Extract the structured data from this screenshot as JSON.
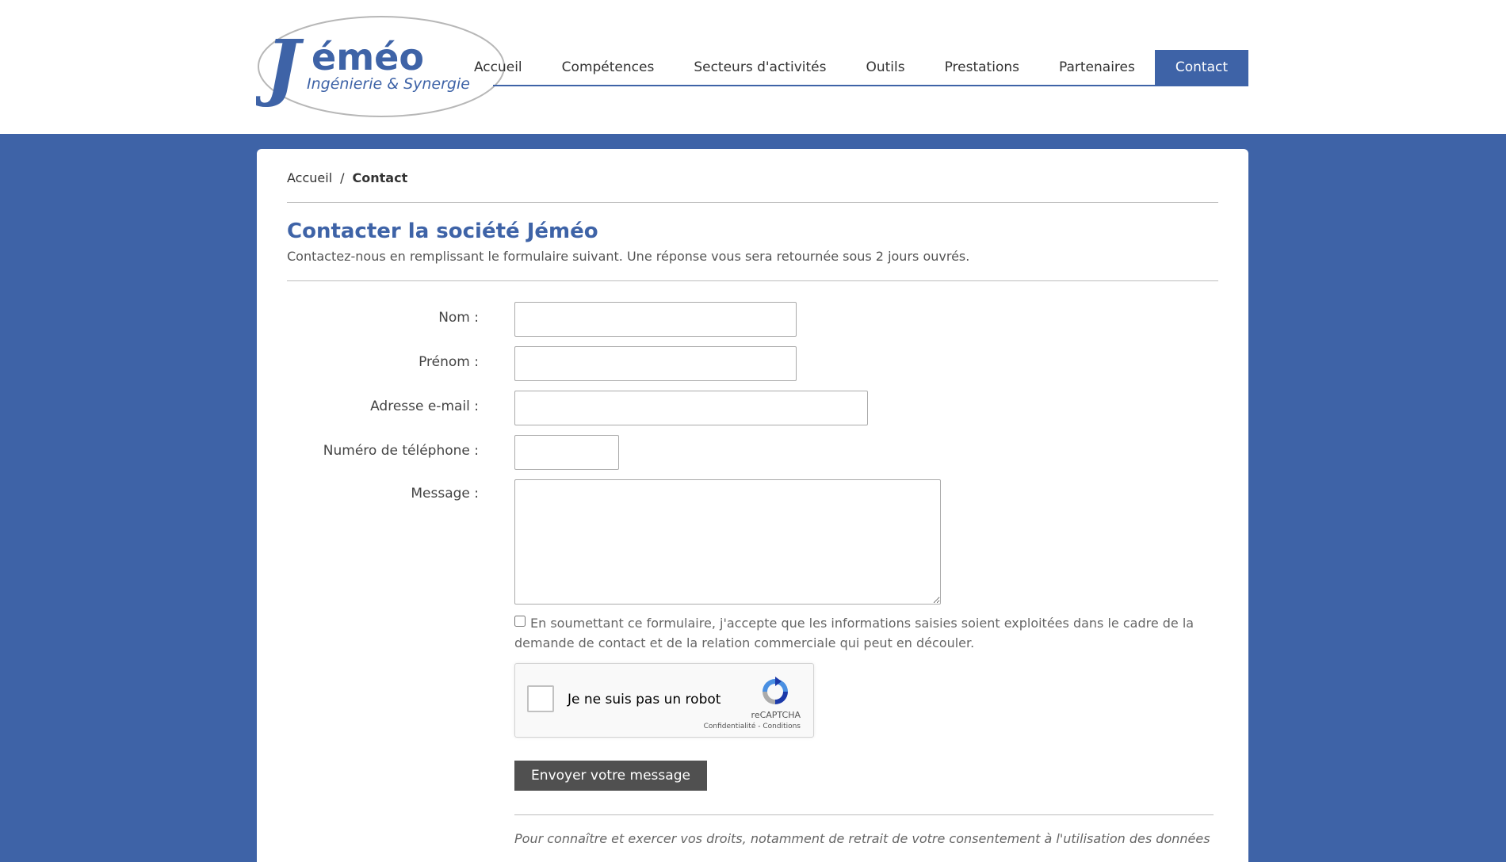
{
  "header": {
    "logo": {
      "name": "Jéméo",
      "tagline": "Ingénierie & Synergie"
    },
    "nav": [
      {
        "label": "Accueil"
      },
      {
        "label": "Compétences"
      },
      {
        "label": "Secteurs d'activités"
      },
      {
        "label": "Outils"
      },
      {
        "label": "Prestations"
      },
      {
        "label": "Partenaires"
      },
      {
        "label": "Contact",
        "active": true
      }
    ]
  },
  "breadcrumb": {
    "home": "Accueil",
    "separator": "/",
    "current": "Contact"
  },
  "page": {
    "title": "Contacter la société Jéméo",
    "intro": "Contactez-nous en remplissant le formulaire suivant. Une réponse vous sera retournée sous 2 jours ouvrés."
  },
  "form": {
    "nom": {
      "label": "Nom :",
      "value": ""
    },
    "prenom": {
      "label": "Prénom :",
      "value": ""
    },
    "email": {
      "label": "Adresse e-mail :",
      "value": ""
    },
    "phone": {
      "label": "Numéro de téléphone :",
      "value": ""
    },
    "message": {
      "label": "Message :",
      "value": ""
    },
    "consent": {
      "checked": false,
      "text": "En soumettant ce formulaire, j'accepte que les informations saisies soient exploitées dans le cadre de la demande de contact et de la relation commerciale qui peut en découler."
    },
    "recaptcha": {
      "label": "Je ne suis pas un robot",
      "brand": "reCAPTCHA",
      "privacy": "Confidentialité",
      "link_separator": "-",
      "terms": "Conditions"
    },
    "submit_label": "Envoyer votre message"
  },
  "privacy_notice": "Pour connaître et exercer vos droits, notamment de retrait de votre consentement à l'utilisation des données",
  "colors": {
    "brand_blue": "#3e63a7",
    "button_gray": "#505050"
  },
  "icons": {
    "recaptcha": "recaptcha-logo-icon"
  }
}
